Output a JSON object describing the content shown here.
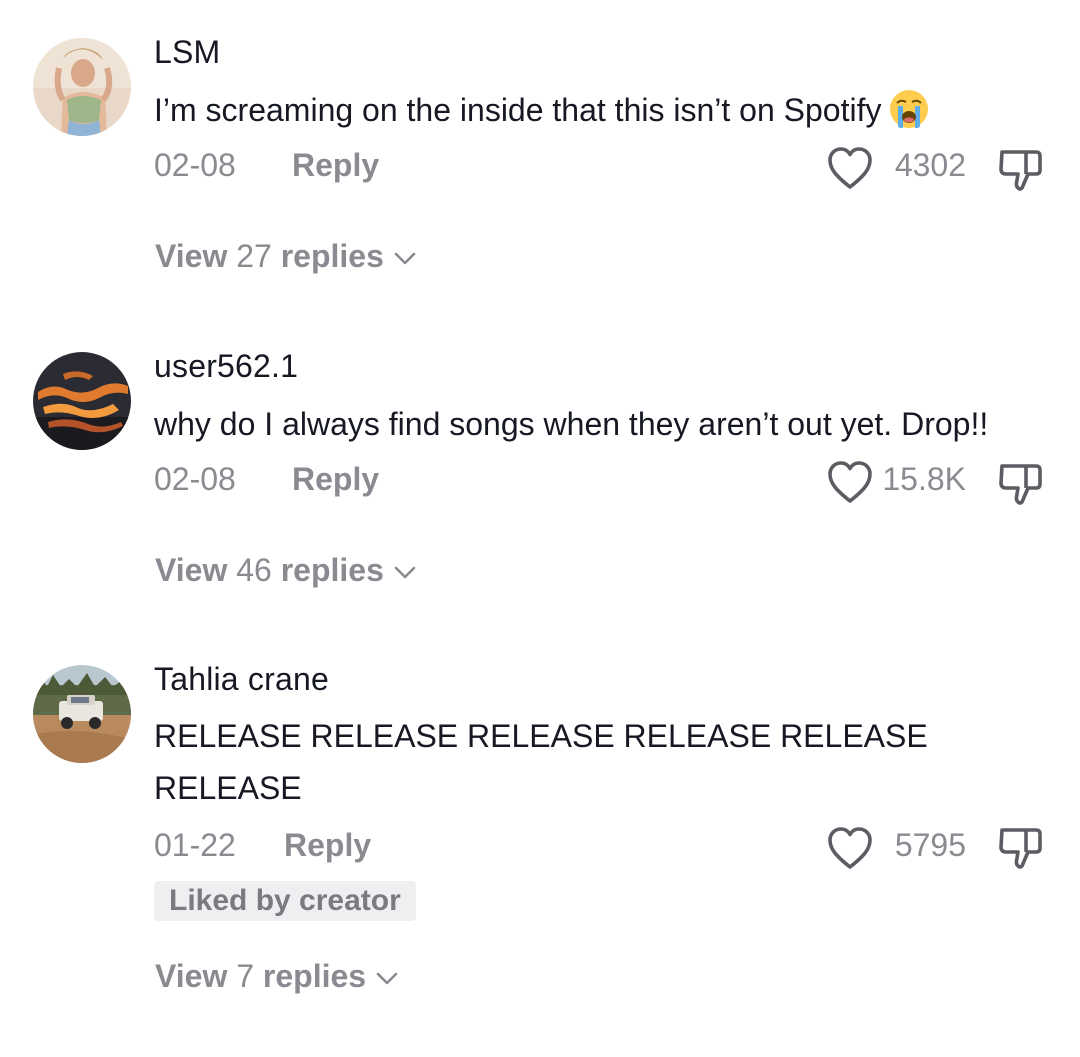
{
  "comments": [
    {
      "username": "LSM",
      "text": "I’m screaming on the inside that this isn’t on Spotify",
      "emoji": "loudly-crying-face",
      "date": "02-08",
      "reply_label": "Reply",
      "likes": "4302",
      "view_replies_prefix": "View",
      "view_replies_count": "27",
      "view_replies_suffix": "replies"
    },
    {
      "username": "user562.1",
      "text": "why do I always find songs when they aren’t out yet. Drop!!",
      "date": "02-08",
      "reply_label": "Reply",
      "likes": "15.8K",
      "view_replies_prefix": "View",
      "view_replies_count": "46",
      "view_replies_suffix": "replies"
    },
    {
      "username": "Tahlia crane",
      "text_line1": "RELEASE RELEASE RELEASE RELEASE RELEASE",
      "text_line2": "RELEASE",
      "date": "01-22",
      "reply_label": "Reply",
      "likes": "5795",
      "badge": "Liked by creator",
      "view_replies_prefix": "View",
      "view_replies_count": "7",
      "view_replies_suffix": "replies"
    }
  ],
  "colors": {
    "text": "#161823",
    "muted": "#8a8b91",
    "badge_bg": "#eeeff1"
  },
  "icons": [
    "heart-icon",
    "dislike-icon",
    "chevron-down-icon"
  ]
}
